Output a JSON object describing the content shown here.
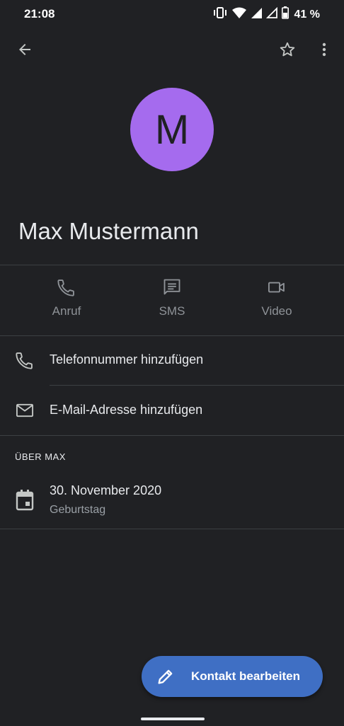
{
  "status_bar": {
    "time": "21:08",
    "battery_percent": "41 %",
    "icons": [
      "vibrate-icon",
      "wifi-icon",
      "signal-icon",
      "signal-icon",
      "battery-icon"
    ]
  },
  "app_bar": {
    "back_icon": "arrow-back-icon",
    "favorite_icon": "star-outline-icon",
    "more_icon": "more-vert-icon"
  },
  "contact": {
    "initial": "M",
    "name": "Max Mustermann",
    "avatar_color": "#a56bee"
  },
  "actions": [
    {
      "label": "Anruf",
      "icon": "phone-icon"
    },
    {
      "label": "SMS",
      "icon": "message-icon"
    },
    {
      "label": "Video",
      "icon": "videocam-icon"
    }
  ],
  "details": {
    "add_phone": "Telefonnummer hinzufügen",
    "add_email": "E-Mail-Adresse hinzufügen"
  },
  "about": {
    "header": "ÜBER MAX",
    "birthday_date": "30. November 2020",
    "birthday_label": "Geburtstag"
  },
  "fab": {
    "label": "Kontakt bearbeiten",
    "icon": "edit-icon",
    "color": "#3f6fc4"
  }
}
